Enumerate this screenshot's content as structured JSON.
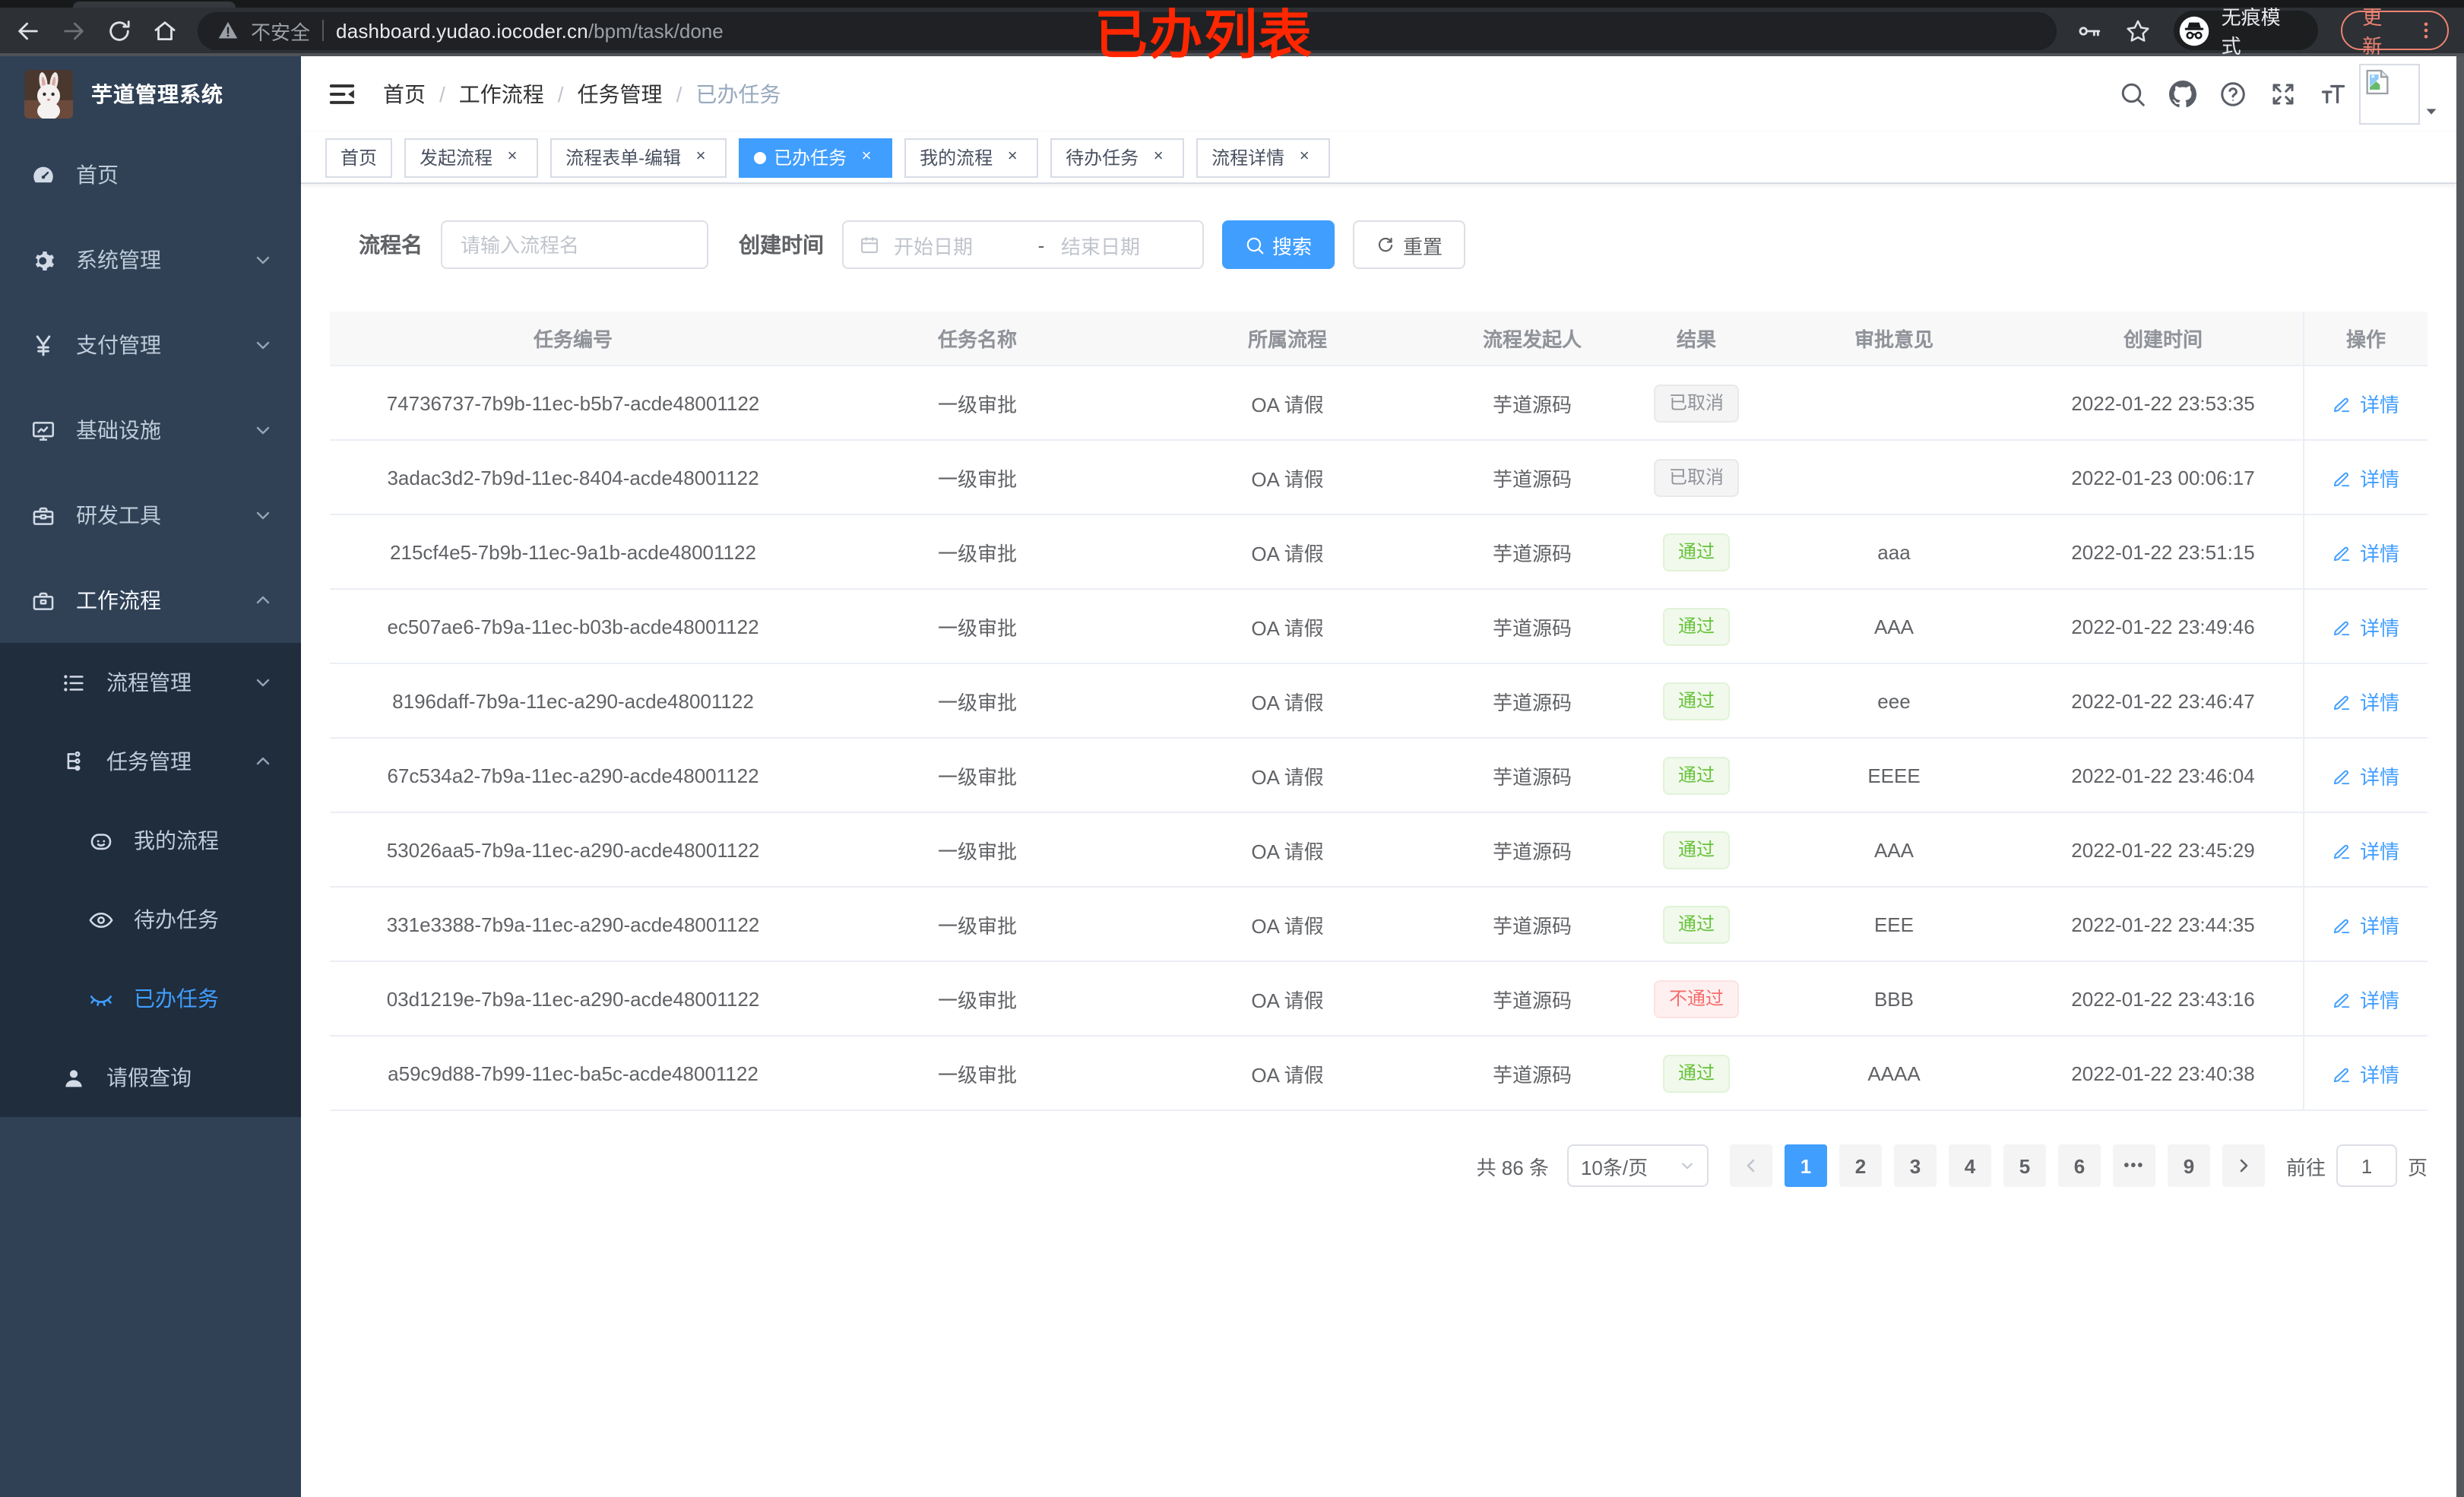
{
  "browser": {
    "security_label": "不安全",
    "url_host": "dashboard.yudao.iocoder.cn",
    "url_path": "/bpm/task/done",
    "incognito_label": "无痕模式",
    "update_label": "更新"
  },
  "annotation": {
    "text": "已办列表",
    "color": "#ff2600"
  },
  "sidebar": {
    "app_title": "芋道管理系统",
    "menu": [
      {
        "label": "首页",
        "icon": "dashboard-icon",
        "level": 0
      },
      {
        "label": "系统管理",
        "icon": "gear-icon",
        "level": 0,
        "arrow": "down"
      },
      {
        "label": "支付管理",
        "icon": "yen-icon",
        "level": 0,
        "arrow": "down"
      },
      {
        "label": "基础设施",
        "icon": "monitor-icon",
        "level": 0,
        "arrow": "down"
      },
      {
        "label": "研发工具",
        "icon": "toolbox-icon",
        "level": 0,
        "arrow": "down"
      },
      {
        "label": "工作流程",
        "icon": "briefcase-icon",
        "level": 0,
        "arrow": "up",
        "open": true
      }
    ],
    "submenu": [
      {
        "label": "流程管理",
        "icon": "list-tree-icon",
        "level": 1,
        "arrow": "down"
      },
      {
        "label": "任务管理",
        "icon": "flow-icon",
        "level": 1,
        "arrow": "up"
      },
      {
        "label": "我的流程",
        "icon": "face-icon",
        "level": 2
      },
      {
        "label": "待办任务",
        "icon": "eye-icon",
        "level": 2
      },
      {
        "label": "已办任务",
        "icon": "eye-closed-icon",
        "level": 2,
        "active": true
      },
      {
        "label": "请假查询",
        "icon": "user-icon",
        "level": 1
      }
    ]
  },
  "header": {
    "breadcrumb": [
      "首页",
      "工作流程",
      "任务管理",
      "已办任务"
    ],
    "icon_names": [
      "search-icon",
      "github-icon",
      "question-icon",
      "fullscreen-icon",
      "fontsize-icon"
    ]
  },
  "tabs": [
    {
      "label": "首页"
    },
    {
      "label": "发起流程",
      "closable": true
    },
    {
      "label": "流程表单-编辑",
      "closable": true
    },
    {
      "label": "已办任务",
      "closable": true,
      "active": true
    },
    {
      "label": "我的流程",
      "closable": true
    },
    {
      "label": "待办任务",
      "closable": true
    },
    {
      "label": "流程详情",
      "closable": true
    }
  ],
  "search_form": {
    "name_label": "流程名",
    "name_placeholder": "请输入流程名",
    "time_label": "创建时间",
    "start_placeholder": "开始日期",
    "range_separator": "-",
    "end_placeholder": "结束日期",
    "search_label": "搜索",
    "reset_label": "重置"
  },
  "table": {
    "columns": [
      "任务编号",
      "任务名称",
      "所属流程",
      "流程发起人",
      "结果",
      "审批意见",
      "创建时间",
      "操作"
    ],
    "detail_label": "详情",
    "rows": [
      {
        "id": "74736737-7b9b-11ec-b5b7-acde48001122",
        "name": "一级审批",
        "process": "OA 请假",
        "starter": "芋道源码",
        "result": "已取消",
        "result_type": "info",
        "comment": "",
        "created": "2022-01-22 23:53:35"
      },
      {
        "id": "3adac3d2-7b9d-11ec-8404-acde48001122",
        "name": "一级审批",
        "process": "OA 请假",
        "starter": "芋道源码",
        "result": "已取消",
        "result_type": "info",
        "comment": "",
        "created": "2022-01-23 00:06:17"
      },
      {
        "id": "215cf4e5-7b9b-11ec-9a1b-acde48001122",
        "name": "一级审批",
        "process": "OA 请假",
        "starter": "芋道源码",
        "result": "通过",
        "result_type": "success",
        "comment": "aaa",
        "created": "2022-01-22 23:51:15"
      },
      {
        "id": "ec507ae6-7b9a-11ec-b03b-acde48001122",
        "name": "一级审批",
        "process": "OA 请假",
        "starter": "芋道源码",
        "result": "通过",
        "result_type": "success",
        "comment": "AAA",
        "created": "2022-01-22 23:49:46"
      },
      {
        "id": "8196daff-7b9a-11ec-a290-acde48001122",
        "name": "一级审批",
        "process": "OA 请假",
        "starter": "芋道源码",
        "result": "通过",
        "result_type": "success",
        "comment": "eee",
        "created": "2022-01-22 23:46:47"
      },
      {
        "id": "67c534a2-7b9a-11ec-a290-acde48001122",
        "name": "一级审批",
        "process": "OA 请假",
        "starter": "芋道源码",
        "result": "通过",
        "result_type": "success",
        "comment": "EEEE",
        "created": "2022-01-22 23:46:04"
      },
      {
        "id": "53026aa5-7b9a-11ec-a290-acde48001122",
        "name": "一级审批",
        "process": "OA 请假",
        "starter": "芋道源码",
        "result": "通过",
        "result_type": "success",
        "comment": "AAA",
        "created": "2022-01-22 23:45:29"
      },
      {
        "id": "331e3388-7b9a-11ec-a290-acde48001122",
        "name": "一级审批",
        "process": "OA 请假",
        "starter": "芋道源码",
        "result": "通过",
        "result_type": "success",
        "comment": "EEE",
        "created": "2022-01-22 23:44:35"
      },
      {
        "id": "03d1219e-7b9a-11ec-a290-acde48001122",
        "name": "一级审批",
        "process": "OA 请假",
        "starter": "芋道源码",
        "result": "不通过",
        "result_type": "danger",
        "comment": "BBB",
        "created": "2022-01-22 23:43:16"
      },
      {
        "id": "a59c9d88-7b99-11ec-ba5c-acde48001122",
        "name": "一级审批",
        "process": "OA 请假",
        "starter": "芋道源码",
        "result": "通过",
        "result_type": "success",
        "comment": "AAAA",
        "created": "2022-01-22 23:40:38"
      }
    ]
  },
  "pagination": {
    "total_label": "共 86 条",
    "page_size_label": "10条/页",
    "pages": [
      {
        "label": "1",
        "active": true
      },
      {
        "label": "2"
      },
      {
        "label": "3"
      },
      {
        "label": "4"
      },
      {
        "label": "5"
      },
      {
        "label": "6"
      },
      {
        "label": "•••",
        "more": true
      },
      {
        "label": "9"
      }
    ],
    "jump_label": "前往",
    "jump_value": "1",
    "page_unit": "页"
  },
  "colors": {
    "accent": "#409eff",
    "success": "#67c23a",
    "danger": "#f56c6c",
    "info": "#909399",
    "sidebar": "#304156",
    "submenu": "#1f2d3d"
  }
}
